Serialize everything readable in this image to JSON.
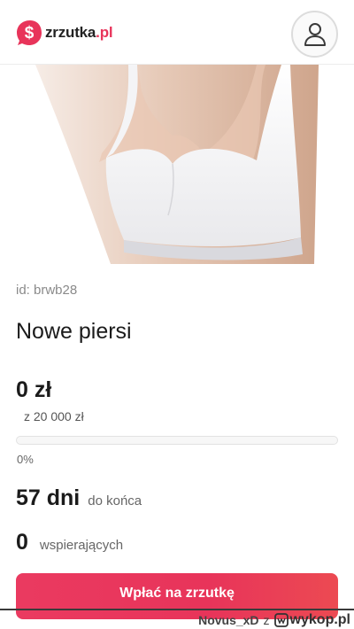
{
  "header": {
    "logo_name": "zrzutka",
    "logo_tld": ".pl",
    "avatar_icon": "user-icon",
    "brand_color": "#e8345a"
  },
  "campaign": {
    "id_label": "id: brwb28",
    "title": "Nowe piersi",
    "raised": "0 zł",
    "goal": "z 20 000 zł",
    "progress_value": 0,
    "progress_label": "0%",
    "days_value": "57 dni",
    "days_label": "do końca",
    "supporters_value": "0",
    "supporters_label": "wspierających",
    "cta_label": "Wpłać na zrzutkę"
  },
  "watermark": {
    "user": "Novus_xD",
    "sep": "z",
    "site": "wykop.pl"
  }
}
